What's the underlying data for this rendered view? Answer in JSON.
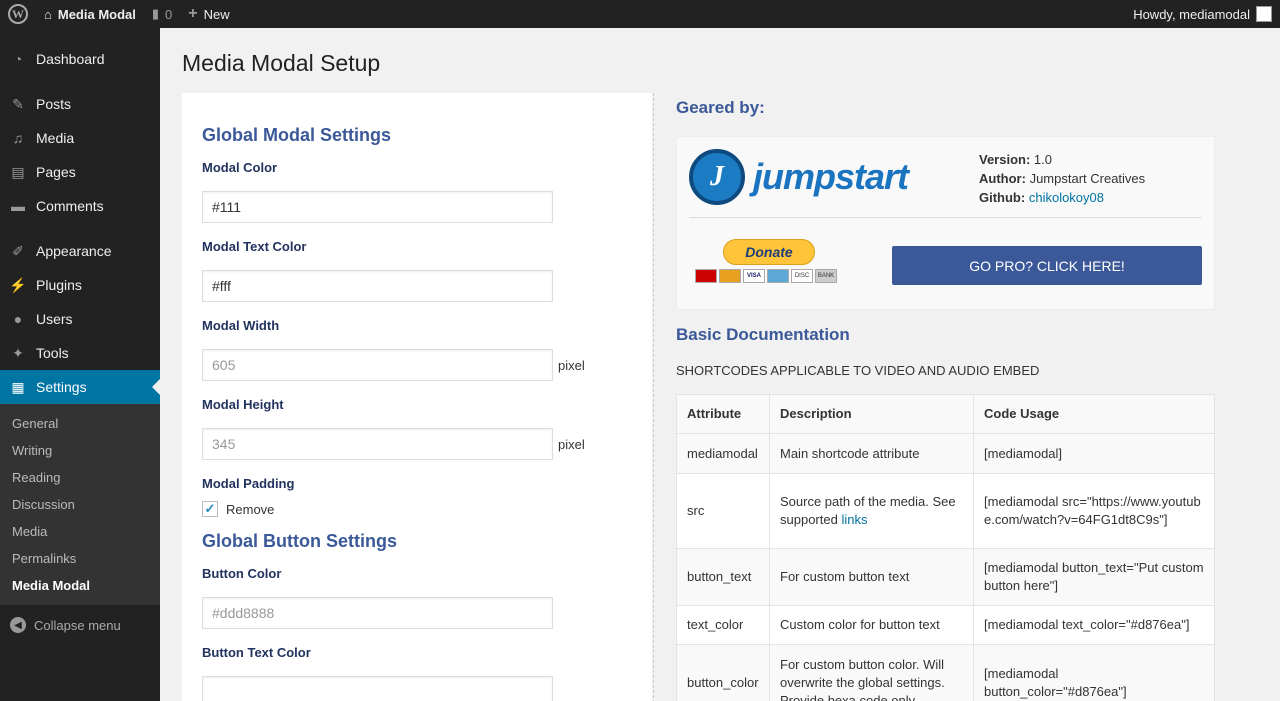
{
  "adminbar": {
    "site_name": "Media Modal",
    "comments_count": "0",
    "new_label": "New",
    "greeting": "Howdy, mediamodal"
  },
  "sidebar": {
    "items": [
      {
        "label": "Dashboard",
        "icon": "dashboard-icon"
      },
      {
        "label": "Posts",
        "icon": "pin-icon"
      },
      {
        "label": "Media",
        "icon": "media-icon"
      },
      {
        "label": "Pages",
        "icon": "pages-icon"
      },
      {
        "label": "Comments",
        "icon": "comment-icon"
      },
      {
        "label": "Appearance",
        "icon": "brush-icon"
      },
      {
        "label": "Plugins",
        "icon": "plugin-icon"
      },
      {
        "label": "Users",
        "icon": "user-icon"
      },
      {
        "label": "Tools",
        "icon": "wrench-icon"
      },
      {
        "label": "Settings",
        "icon": "settings-icon"
      }
    ],
    "submenu": [
      "General",
      "Writing",
      "Reading",
      "Discussion",
      "Media",
      "Permalinks",
      "Media Modal"
    ],
    "collapse_label": "Collapse menu"
  },
  "page": {
    "title": "Media Modal Setup"
  },
  "form": {
    "global_modal_title": "Global Modal Settings",
    "modal_color_label": "Modal Color",
    "modal_color_value": "#111",
    "modal_text_color_label": "Modal Text Color",
    "modal_text_color_value": "#fff",
    "modal_width_label": "Modal Width",
    "modal_width_placeholder": "605",
    "modal_height_label": "Modal Height",
    "modal_height_placeholder": "345",
    "unit": "pixel",
    "modal_padding_label": "Modal Padding",
    "remove_label": "Remove",
    "remove_checked": true,
    "global_button_title": "Global Button Settings",
    "button_color_label": "Button Color",
    "button_color_placeholder": "#ddd8888",
    "button_text_color_label": "Button Text Color"
  },
  "sponsor": {
    "geared_by": "Geared by:",
    "logo_text": "jumpstart",
    "version_label": "Version:",
    "version_value": "1.0",
    "author_label": "Author:",
    "author_value": "Jumpstart Creatives",
    "github_label": "Github:",
    "github_value": "chikolokoy08",
    "donate_label": "Donate",
    "cards": [
      "Maestro",
      "MasterCard",
      "VISA",
      "AMEX",
      "DISCOVER",
      "BANK"
    ],
    "go_pro_label": "GO PRO? CLICK HERE!"
  },
  "docs": {
    "title": "Basic Documentation",
    "subtitle": "SHORTCODES APPLICABLE TO VIDEO AND AUDIO EMBED",
    "headers": [
      "Attribute",
      "Description",
      "Code Usage"
    ],
    "rows": [
      {
        "attribute": "mediamodal",
        "description": "Main shortcode attribute",
        "usage": "[mediamodal]"
      },
      {
        "attribute": "src",
        "description": "Source path of the media. See supported",
        "link": "links",
        "usage": "[mediamodal src=\"https://www.youtube.com/watch?v=64FG1dt8C9s\"]"
      },
      {
        "attribute": "button_text",
        "description": "For custom button text",
        "usage": "[mediamodal button_text=\"Put custom button here\"]"
      },
      {
        "attribute": "text_color",
        "description": "Custom color for button text",
        "usage": "[mediamodal text_color=\"#d876ea\"]"
      },
      {
        "attribute": "button_color",
        "description": "For custom button color. Will overwrite the global settings. Provide hexa code only.",
        "usage": "[mediamodal button_color=\"#d876ea\"]"
      }
    ]
  },
  "colors": {
    "adminbar_bg": "#222222",
    "sidebar_bg": "#222222",
    "submenu_bg": "#333333",
    "active_menu": "#0074a2",
    "heading_blue": "#3b5998",
    "label_navy": "#22335f",
    "go_pro_bg": "#3b5998",
    "donate_yellow": "#ffc439"
  }
}
